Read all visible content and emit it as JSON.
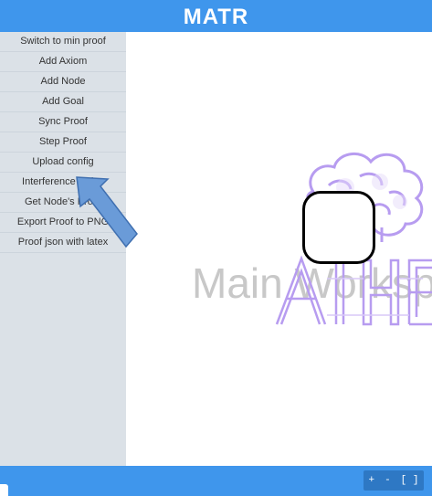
{
  "header": {
    "title": "MATR"
  },
  "sidebar": {
    "items": [
      {
        "label": "Switch to min proof"
      },
      {
        "label": "Add Axiom"
      },
      {
        "label": "Add Node"
      },
      {
        "label": "Add Goal"
      },
      {
        "label": "Sync Proof"
      },
      {
        "label": "Step Proof"
      },
      {
        "label": "Upload config"
      },
      {
        "label": "Interference Rules"
      },
      {
        "label": "Get Node's Proof"
      },
      {
        "label": "Export Proof to PNG"
      },
      {
        "label": "Proof json with latex"
      }
    ]
  },
  "workspace": {
    "watermark": "Main Workspace",
    "logo_text": "AIHE"
  },
  "footer": {
    "zoom_in": "+",
    "zoom_out": "-",
    "fit": "[ ]"
  },
  "colors": {
    "accent": "#3f96ec",
    "sidebar_bg": "#dbe1e7",
    "logo_purple": "#b79cf0",
    "arrow_blue": "#6a9bd8"
  }
}
